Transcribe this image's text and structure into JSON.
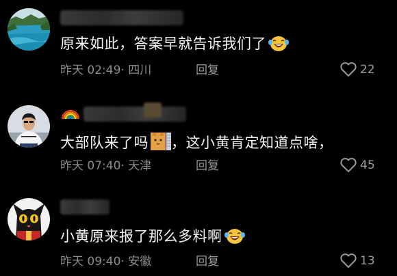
{
  "comments": [
    {
      "text": "原来如此，答案早就告诉我们了",
      "time": "昨天 02:49",
      "location": "· 四川",
      "reply_label": "回复",
      "likes": "22",
      "avatar_icon": "lake-landscape-avatar",
      "emoji_icon": "laughing-tears-emoji"
    },
    {
      "text_before": "大部队来了吗",
      "text_after": "，这小黄肯定知道点啥，",
      "time": "昨天 07:40",
      "location": "· 天津",
      "reply_label": "回复",
      "likes": "45",
      "avatar_icon": "person-photo-avatar",
      "name_icon": "rainbow-icon",
      "sticker_icon": "cat-sticker-icon"
    },
    {
      "text": "小黄原来报了那么多料啊",
      "time": "昨天 09:40",
      "location": "· 安徽",
      "reply_label": "回复",
      "likes": "13",
      "avatar_icon": "black-cat-avatar",
      "emoji_icon": "laughing-tears-emoji"
    }
  ],
  "colors": {
    "background": "#000000",
    "text": "#f4f4f4",
    "meta": "#8c8c8c"
  }
}
